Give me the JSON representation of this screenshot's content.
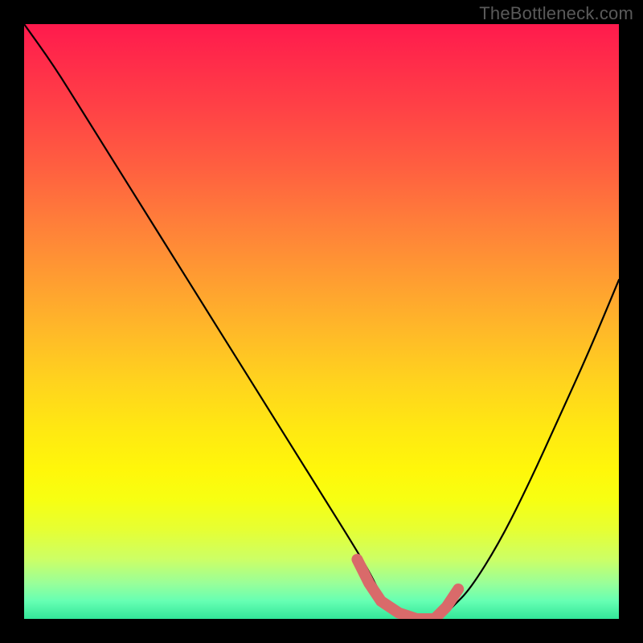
{
  "watermark": "TheBottleneck.com",
  "colors": {
    "background": "#000000",
    "curve": "#000000",
    "marker": "#d96a6a",
    "gradient_top": "#ff1a4d",
    "gradient_bottom": "#33e699",
    "watermark_text": "#5a5a5a"
  },
  "chart_data": {
    "type": "line",
    "title": "",
    "xlabel": "",
    "ylabel": "",
    "xlim": [
      0,
      100
    ],
    "ylim": [
      0,
      100
    ],
    "description": "Bottleneck V-curve on red-to-green vertical gradient; y-value ≈ percent bottleneck (100=worst at top, 0=best at bottom). Pink marker highlights near-zero optimal range.",
    "gradient": {
      "orientation": "vertical",
      "stops": [
        {
          "pos": 0,
          "color": "#ff1a4d"
        },
        {
          "pos": 50,
          "color": "#ffd31e"
        },
        {
          "pos": 80,
          "color": "#fff70a"
        },
        {
          "pos": 100,
          "color": "#33e699"
        }
      ]
    },
    "series": [
      {
        "name": "bottleneck-curve",
        "x": [
          0,
          5,
          10,
          15,
          20,
          25,
          30,
          35,
          40,
          45,
          50,
          55,
          58,
          60,
          62,
          65,
          68,
          70,
          72,
          75,
          80,
          85,
          90,
          95,
          100
        ],
        "y": [
          100,
          93,
          85,
          77,
          69,
          61,
          53,
          45,
          37,
          29,
          21,
          13,
          8,
          4,
          2,
          0,
          0,
          0,
          2,
          5,
          13,
          23,
          34,
          45,
          57
        ]
      }
    ],
    "marker": {
      "name": "optimal-range",
      "x": [
        56,
        58,
        60,
        63,
        66,
        69,
        71,
        73
      ],
      "y": [
        10,
        6,
        3,
        1,
        0,
        0,
        2,
        5
      ]
    }
  }
}
